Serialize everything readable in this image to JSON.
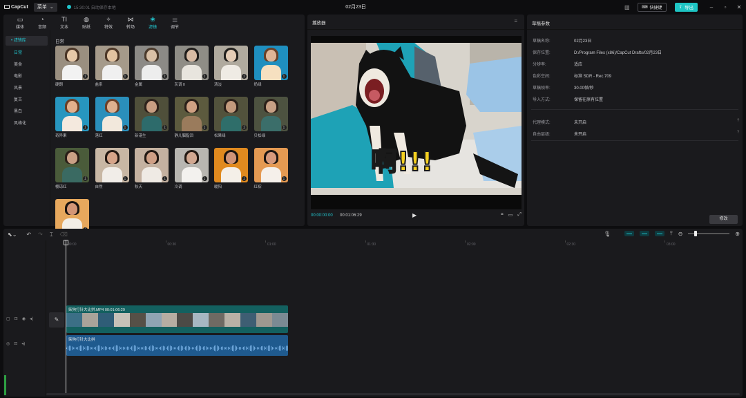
{
  "app": {
    "logo": "CapCut",
    "menu_label": "菜单"
  },
  "save_status": "15:30:01 自动保存本地",
  "project_title": "02月23日",
  "titlebar": {
    "shortcut_label": "快捷键",
    "export_label": "导出"
  },
  "tools": [
    {
      "label": "媒体",
      "icon": "media-icon",
      "glyph": "▭"
    },
    {
      "label": "音频",
      "icon": "audio-icon",
      "glyph": "◔"
    },
    {
      "label": "文本",
      "icon": "text-icon",
      "glyph": "TI"
    },
    {
      "label": "贴纸",
      "icon": "sticker-icon",
      "glyph": "◍"
    },
    {
      "label": "特效",
      "icon": "effects-icon",
      "glyph": "✧"
    },
    {
      "label": "转场",
      "icon": "transition-icon",
      "glyph": "⋈"
    },
    {
      "label": "滤镜",
      "icon": "filter-icon",
      "glyph": "❀"
    },
    {
      "label": "调节",
      "icon": "adjust-icon",
      "glyph": "⚌"
    }
  ],
  "active_tool": "滤镜",
  "sidebar": {
    "library_label": "• 滤镜库",
    "items": [
      "日常",
      "美食",
      "电影",
      "风景",
      "复古",
      "黑白",
      "风格化"
    ]
  },
  "filters": {
    "section_title": "日常",
    "items": [
      "硬朗",
      "盐系",
      "金属",
      "灰调 II",
      "清淡",
      "奶绿",
      "奇异果",
      "落红",
      "新港生",
      "静儿胭脂泪",
      "松果绿",
      "贝松绿",
      "樱琼红",
      "自然",
      "秋天",
      "冷调",
      "暖阳",
      "红棕",
      "橙日"
    ]
  },
  "player": {
    "title": "播放器",
    "current_time": "00:00:00:00",
    "total_time": "00:01:06:29",
    "caption": "啊!!!"
  },
  "draft_params": {
    "title": "草稿参数",
    "rows": [
      {
        "key": "草稿名称:",
        "value": "02月23日"
      },
      {
        "key": "保存位置:",
        "value": "D:/Program Files (x86)/CapCut Drafts/02月23日"
      },
      {
        "key": "分辨率:",
        "value": "适应"
      },
      {
        "key": "色彩空间:",
        "value": "标准 SDR - Rec.709"
      },
      {
        "key": "草稿帧率:",
        "value": "30.00帧/秒"
      },
      {
        "key": "导入方式:",
        "value": "保留在原有位置"
      }
    ],
    "extra_rows": [
      {
        "key": "代理模式:",
        "value": "未开启"
      },
      {
        "key": "自由层级:",
        "value": "未开启"
      }
    ],
    "edit_label": "修改"
  },
  "timeline": {
    "ruler_labels": [
      "00:00",
      "00:30",
      "01:00",
      "01:30",
      "02:00",
      "02:30",
      "03:00"
    ],
    "video_clip_label": "柴狗打针大比拼.MP4   00:01:06:29",
    "audio_clip_label": "柴狗打针大比拼",
    "zoom_fraction": 0.15
  },
  "colors": {
    "accent": "#22c7d0",
    "export": "#1ec5c4",
    "video_clip": "#13605f",
    "audio_clip": "#1f5a8e"
  }
}
